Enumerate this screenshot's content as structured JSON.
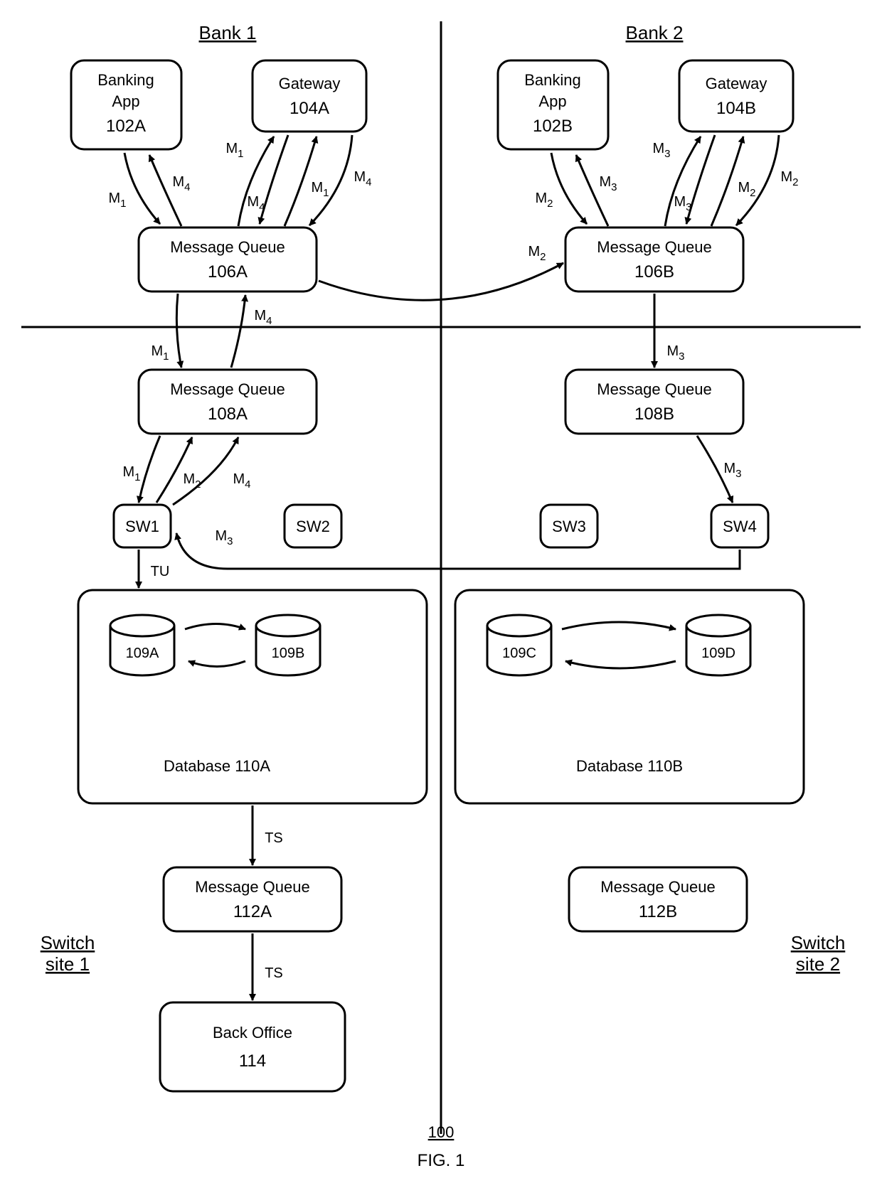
{
  "headers": {
    "bank1": "Bank 1",
    "bank2": "Bank 2",
    "site1": "Switch site 1",
    "site2": "Switch site 2"
  },
  "nodes": {
    "bankingApp102A": {
      "l1": "Banking",
      "l2": "App",
      "l3": "102A"
    },
    "gateway104A": {
      "l1": "Gateway",
      "l2": "104A"
    },
    "bankingApp102B": {
      "l1": "Banking",
      "l2": "App",
      "l3": "102B"
    },
    "gateway104B": {
      "l1": "Gateway",
      "l2": "104B"
    },
    "mq106A": {
      "l1": "Message Queue",
      "l2": "106A"
    },
    "mq106B": {
      "l1": "Message Queue",
      "l2": "106B"
    },
    "mq108A": {
      "l1": "Message Queue",
      "l2": "108A"
    },
    "mq108B": {
      "l1": "Message Queue",
      "l2": "108B"
    },
    "sw1": "SW1",
    "sw2": "SW2",
    "sw3": "SW3",
    "sw4": "SW4",
    "db110A": {
      "l1": "Database",
      "l2": "110A"
    },
    "db110B": {
      "l1": "Database",
      "l2": "110B"
    },
    "d109A": "109A",
    "d109B": "109B",
    "d109C": "109C",
    "d109D": "109D",
    "mq112A": {
      "l1": "Message Queue",
      "l2": "112A"
    },
    "mq112B": {
      "l1": "Message Queue",
      "l2": "112B"
    },
    "backOffice": {
      "l1": "Back Office",
      "l2": "114"
    }
  },
  "messages": {
    "m1": "M",
    "m2": "M",
    "m3": "M",
    "m4": "M",
    "s1": "1",
    "s2": "2",
    "s3": "3",
    "s4": "4",
    "tu": "TU",
    "ts": "TS"
  },
  "figure": {
    "num": "100",
    "label": "FIG. 1"
  }
}
